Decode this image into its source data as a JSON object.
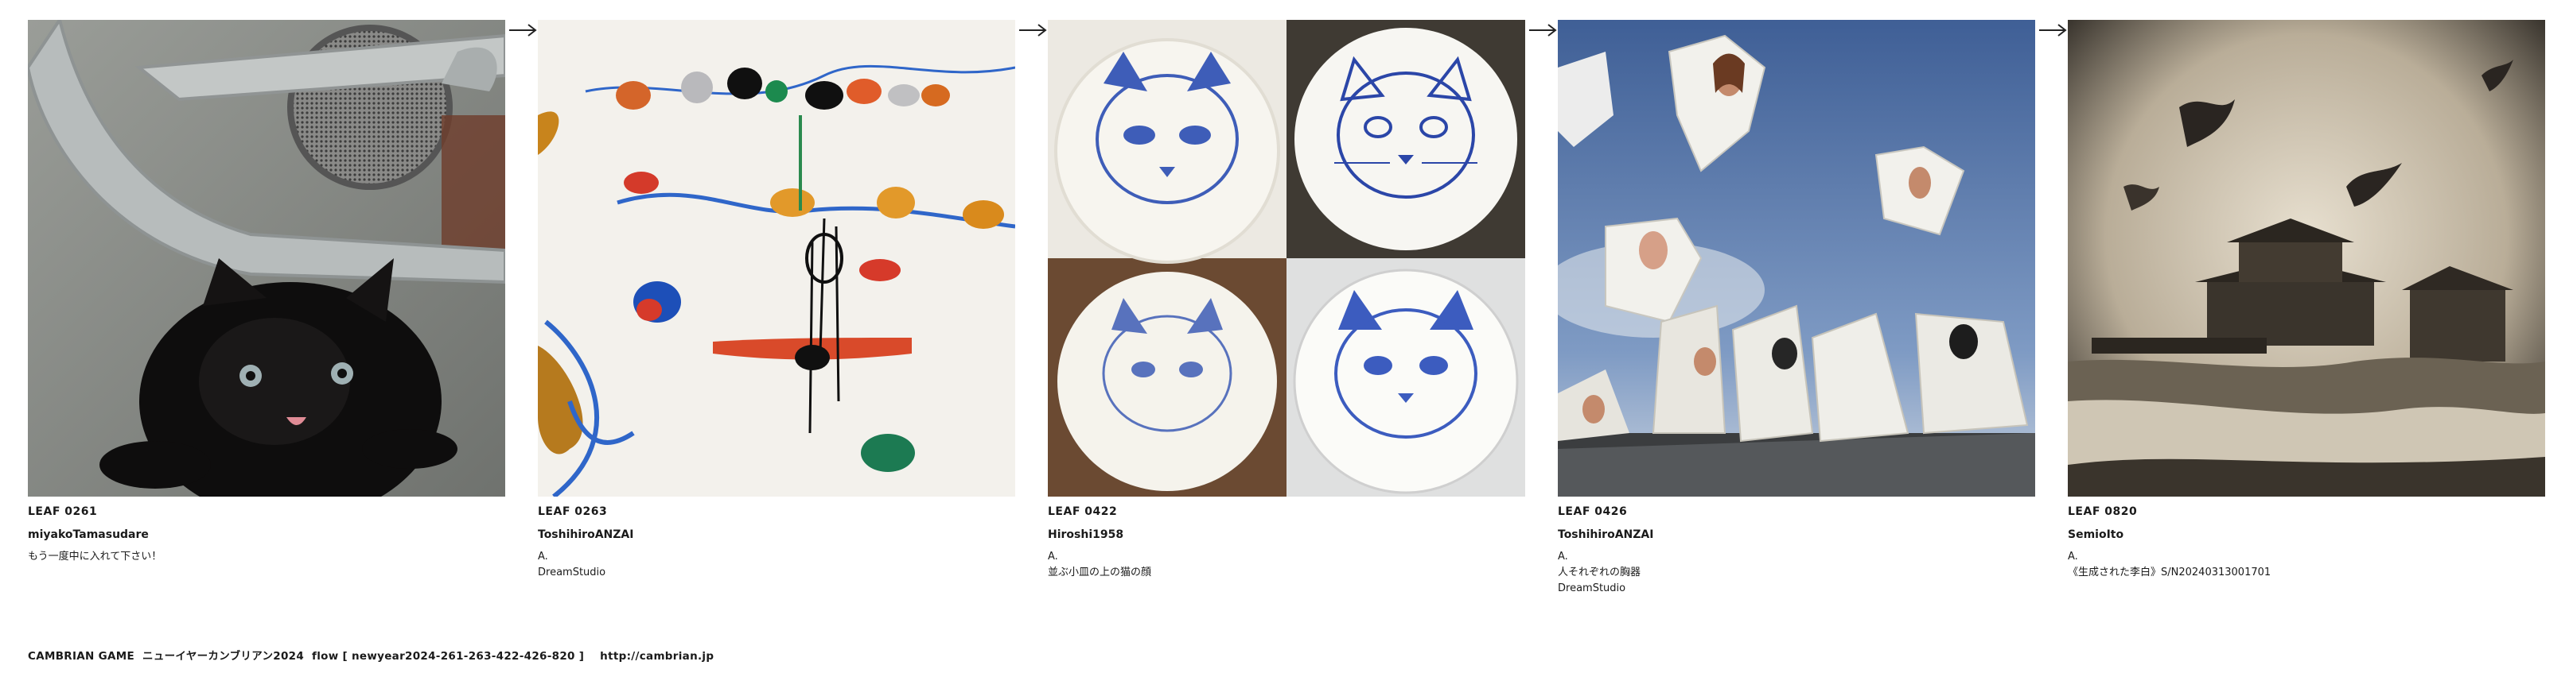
{
  "leaves": [
    {
      "id": "LEAF 0261",
      "author": "miyakoTamasudare",
      "lines": [
        "もう一度中に入れて下さい！"
      ]
    },
    {
      "id": "LEAF 0263",
      "author": "ToshihiroANZAI",
      "lines": [
        "A.",
        "DreamStudio"
      ]
    },
    {
      "id": "LEAF 0422",
      "author": "Hiroshi1958",
      "lines": [
        "A.",
        "並ぶ小皿の上の猫の顔"
      ]
    },
    {
      "id": "LEAF 0426",
      "author": "ToshihiroANZAI",
      "lines": [
        "A.",
        "人それぞれの胸器",
        "DreamStudio"
      ]
    },
    {
      "id": "LEAF 0820",
      "author": "SemioIto",
      "lines": [
        "A.",
        "《生成された李白》S/N20240313001701"
      ]
    }
  ],
  "icons": {
    "arrow": "right-arrow-icon"
  },
  "footer": {
    "text": "CAMBRIAN GAME  ニューイヤーカンブリアン2024  flow [ newyear2024-261-263-422-426-820 ]    http://cambrian.jp"
  }
}
